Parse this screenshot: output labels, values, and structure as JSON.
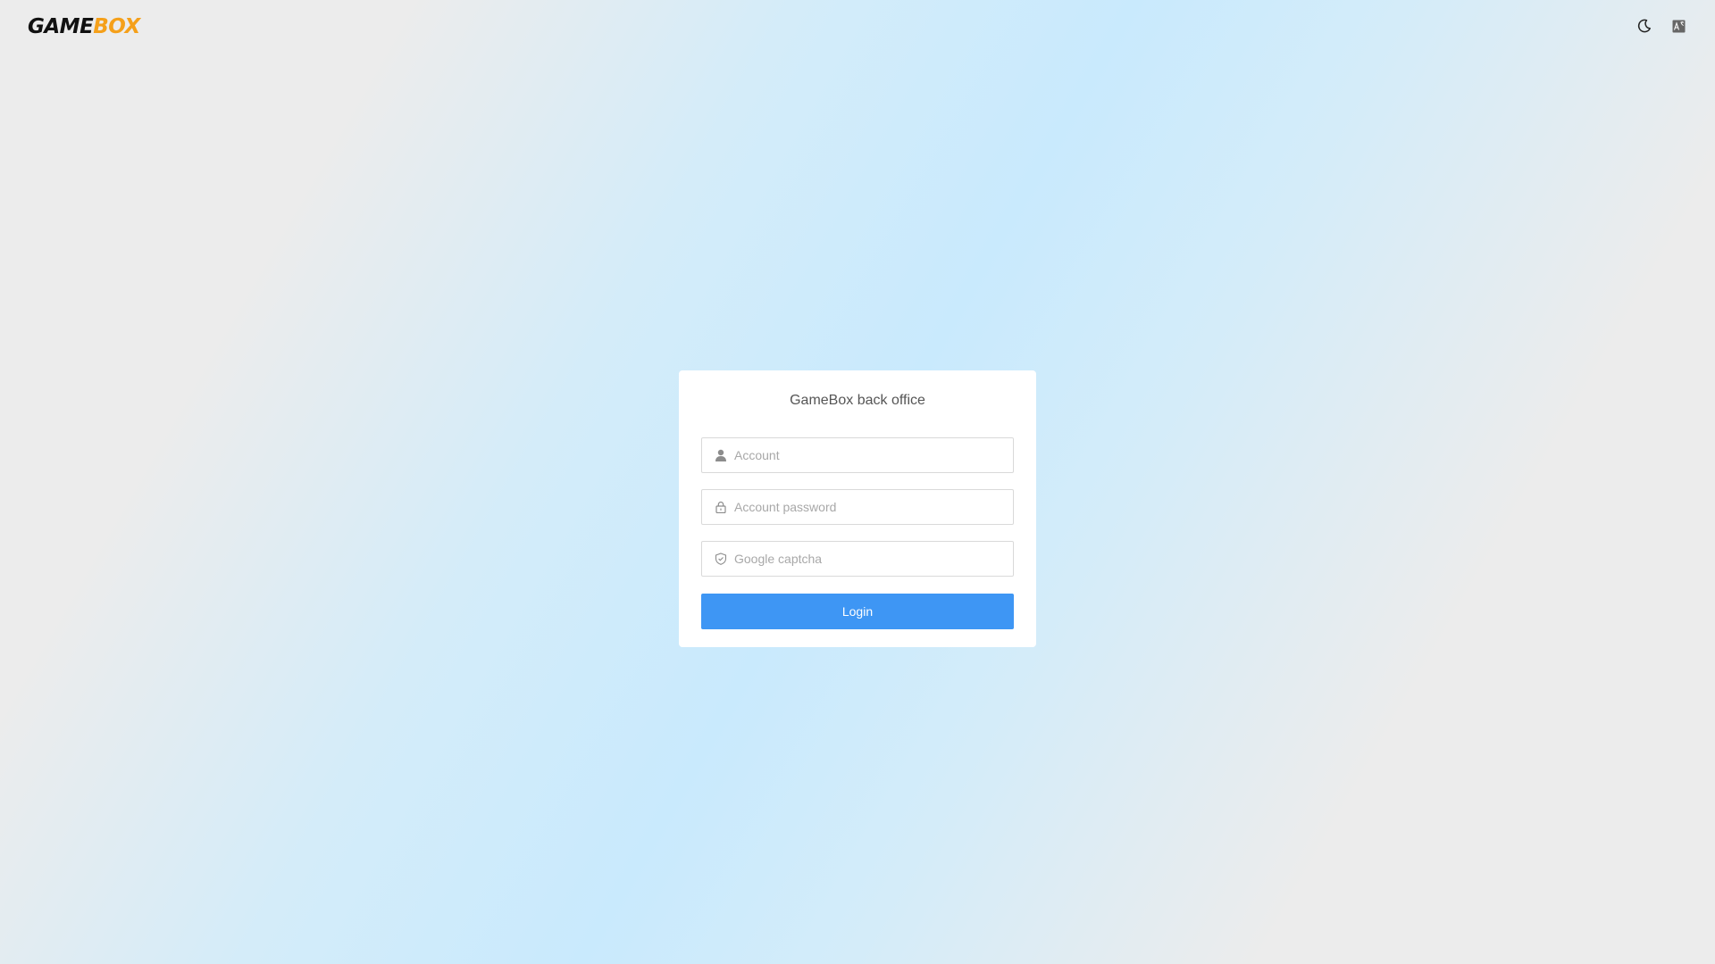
{
  "header": {
    "logo_part1": "GAME",
    "logo_part2": "BOX",
    "logo_colors": {
      "game": "#111111",
      "box": "#f5a01a"
    },
    "theme_toggle_icon": "moon-icon",
    "language_icon": "translate-icon"
  },
  "login": {
    "title": "GameBox back office",
    "account_placeholder": "Account",
    "password_placeholder": "Account password",
    "captcha_placeholder": "Google captcha",
    "submit_label": "Login",
    "account_icon": "user-icon",
    "password_icon": "lock-icon",
    "captcha_icon": "shield-icon",
    "accent_color": "#3e96f4"
  }
}
